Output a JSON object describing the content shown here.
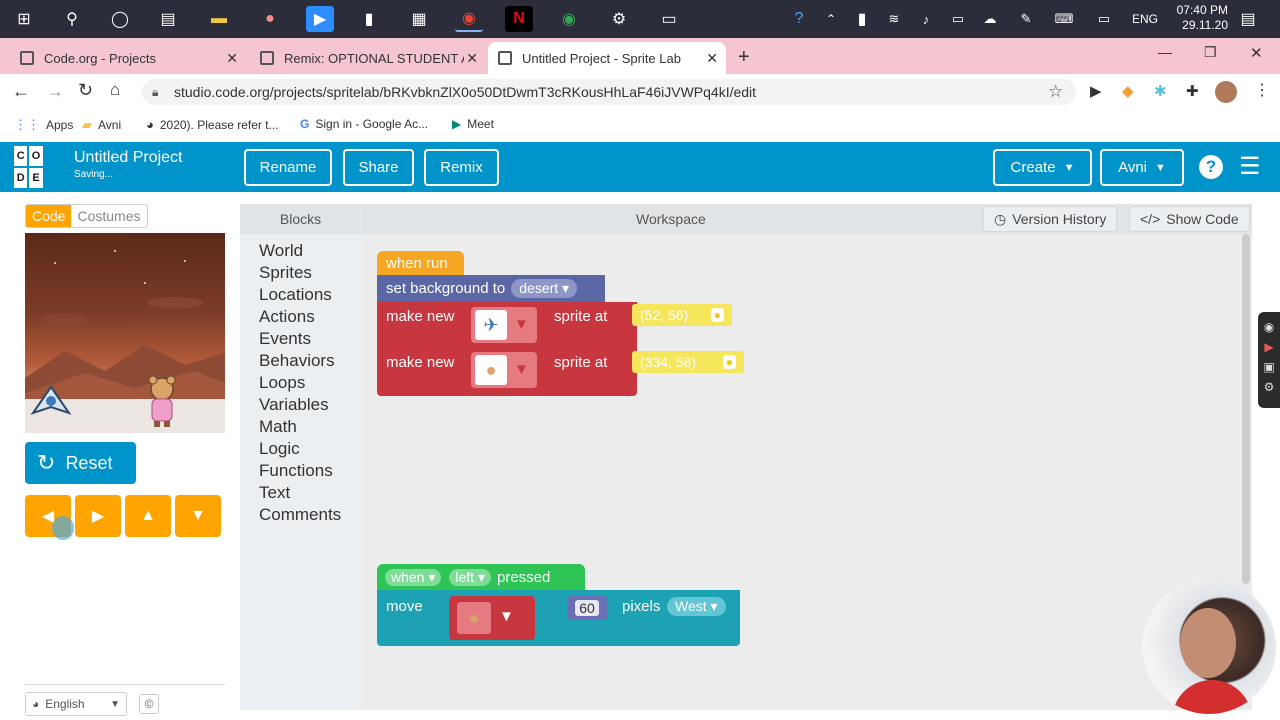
{
  "taskbar": {
    "time": "07:40 PM",
    "date": "29.11.20",
    "lang": "ENG"
  },
  "browser": {
    "tabs": [
      {
        "label": "Code.org - Projects"
      },
      {
        "label": "Remix: OPTIONAL STUDENT ACT"
      },
      {
        "label": "Untitled Project - Sprite Lab"
      }
    ],
    "url": "studio.code.org/projects/spritelab/bRKvbknZlX0o50DtDwmT3cRKousHhLaF46iJVWPq4kI/edit",
    "bookmarks": [
      {
        "label": "Apps"
      },
      {
        "label": "Avni"
      },
      {
        "label": "2020). Please refer t..."
      },
      {
        "label": "Sign in - Google Ac..."
      },
      {
        "label": "Meet"
      }
    ]
  },
  "header": {
    "logo_letters": [
      "C",
      "O",
      "",
      "D",
      "E",
      ""
    ],
    "project_title": "Untitled Project",
    "status": "Saving...",
    "rename": "Rename",
    "share": "Share",
    "remix": "Remix",
    "create": "Create",
    "user": "Avni"
  },
  "left": {
    "tab_code": "Code",
    "tab_costumes": "Costumes",
    "reset": "Reset",
    "language": "English"
  },
  "toolbox": {
    "title": "Blocks",
    "categories": [
      "World",
      "Sprites",
      "Locations",
      "Actions",
      "Events",
      "Behaviors",
      "Loops",
      "Variables",
      "Math",
      "Logic",
      "Functions",
      "Text",
      "Comments"
    ]
  },
  "workspace": {
    "title": "Workspace",
    "version_history": "Version History",
    "show_code": "Show Code"
  },
  "blocks": {
    "when_run": "when run",
    "set_bg": "set background to",
    "bg_value": "desert",
    "make_new": "make new",
    "sprite_at": "sprite at",
    "loc1": "(52, 56)",
    "loc2": "(334, 58)",
    "when": "when",
    "key": "left",
    "pressed": "pressed",
    "move": "move",
    "amount": "60",
    "pixels": "pixels",
    "direction": "West"
  },
  "colors": {
    "header": "#0094ca",
    "events": "#f5a623",
    "world": "#5b67a5",
    "sprites": "#c8363f",
    "locations": "#f5e65b",
    "actions": "#1da2b4",
    "keyevent": "#2ec456",
    "arrows": "#ffa400"
  }
}
